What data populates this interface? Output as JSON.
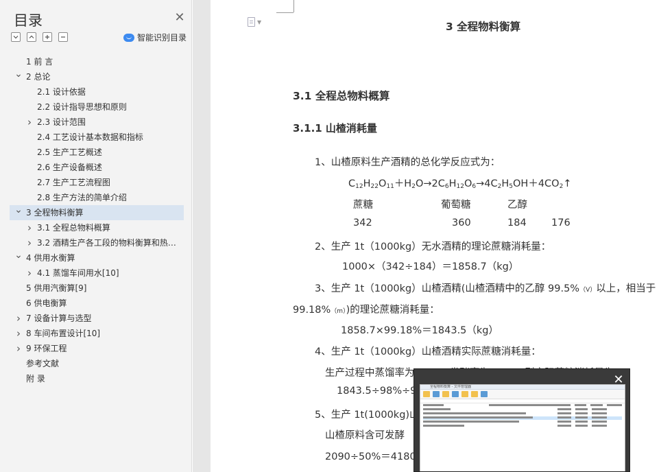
{
  "toc": {
    "title": "目录",
    "smart_label": "智能识别目录",
    "items": [
      {
        "label": "1 前  言",
        "level": 1,
        "chevron": ""
      },
      {
        "label": "2 总论",
        "level": 1,
        "chevron": "expanded"
      },
      {
        "label": "2.1 设计依据",
        "level": 2,
        "chevron": ""
      },
      {
        "label": "2.2 设计指导思想和原则",
        "level": 2,
        "chevron": ""
      },
      {
        "label": "2.3 设计范围",
        "level": 2,
        "chevron": "collapsed"
      },
      {
        "label": "2.4 工艺设计基本数据和指标",
        "level": 2,
        "chevron": ""
      },
      {
        "label": "2.5 生产工艺概述",
        "level": 2,
        "chevron": ""
      },
      {
        "label": "2.6 生产设备概述",
        "level": 2,
        "chevron": ""
      },
      {
        "label": "2.7 生产工艺流程图",
        "level": 2,
        "chevron": ""
      },
      {
        "label": "2.8 生产方法的简单介绍",
        "level": 2,
        "chevron": ""
      },
      {
        "label": "3 全程物料衡算",
        "level": 1,
        "chevron": "expanded",
        "selected": true
      },
      {
        "label": "3.1 全程总物料概算",
        "level": 2,
        "chevron": "collapsed"
      },
      {
        "label": "3.2 酒精生产各工段的物料衡算和热…",
        "level": 2,
        "chevron": "collapsed"
      },
      {
        "label": "4  供用水衡算",
        "level": 1,
        "chevron": "expanded"
      },
      {
        "label": "4.1 蒸馏车间用水[10]",
        "level": 2,
        "chevron": "collapsed"
      },
      {
        "label": "5 供用汽衡算[9]",
        "level": 1,
        "chevron": ""
      },
      {
        "label": "6 供电衡算",
        "level": 1,
        "chevron": ""
      },
      {
        "label": "7 设备计算与选型",
        "level": 1,
        "chevron": "collapsed"
      },
      {
        "label": "8 车间布置设计[10]",
        "level": 1,
        "chevron": "collapsed"
      },
      {
        "label": "9 环保工程",
        "level": 1,
        "chevron": "collapsed"
      },
      {
        "label": "参考文献",
        "level": 1,
        "chevron": ""
      },
      {
        "label": "附  录",
        "level": 1,
        "chevron": ""
      }
    ]
  },
  "doc": {
    "chapter_title": "3 全程物料衡算",
    "section_title": "3.1 全程总物料概算",
    "subsection_title": "3.1.1 山楂消耗量",
    "p1": "1、山楂原料生产酒精的总化学反应式为：",
    "eq_parts": {
      "a": "C",
      "a1": "12",
      "b": "H",
      "b1": "22",
      "c": "O",
      "c1": "11",
      "d": "＋H",
      "d1": "2",
      "e": "O→2C",
      "e1": "6",
      "f": "H",
      "f1": "12",
      "g": "O",
      "g1": "6",
      "h": "→4C",
      "h1": "2",
      "i": "H",
      "i1": "5",
      "j": "OH＋4CO",
      "j1": "2",
      "k": "↑"
    },
    "names": [
      "蔗糖",
      "葡萄糖",
      "乙醇"
    ],
    "masses": [
      "342",
      "360",
      "184",
      "176"
    ],
    "p2": "2、生产 1t（1000kg）无水酒精的理论蔗糖消耗量：",
    "p2_calc": "1000×（342÷184）＝1858.7（kg）",
    "p3a": "3、生产 1t（1000kg）山楂酒精(山楂酒精中的乙醇 99.5%",
    "p3a_sub": "（V）",
    "p3a_tail": "以上，相当于",
    "p3b": "99.18%",
    "p3b_sub": "（m）",
    "p3b_tail": ")的理论蔗糖消耗量：",
    "p3_calc": "1858.7×99.18%＝1843.5（kg）",
    "p4": "4、生产 1t（1000kg）山楂酒精实际蔗糖消耗量：",
    "p4_line": "生产过程中蒸馏率为 98%，发酵率为 90%，则实际蔗糖消耗量为：",
    "p4_calc": "1843.5÷98%÷90%",
    "p5": "5、生产 1t(1000kg)山",
    "p5_line": "山楂原料含可发酵",
    "p5_calc": "2090÷50%＝4180（"
  },
  "thumbnail": {
    "close_label": "✕",
    "title": "全程物料衡算 - 文件管理器"
  }
}
